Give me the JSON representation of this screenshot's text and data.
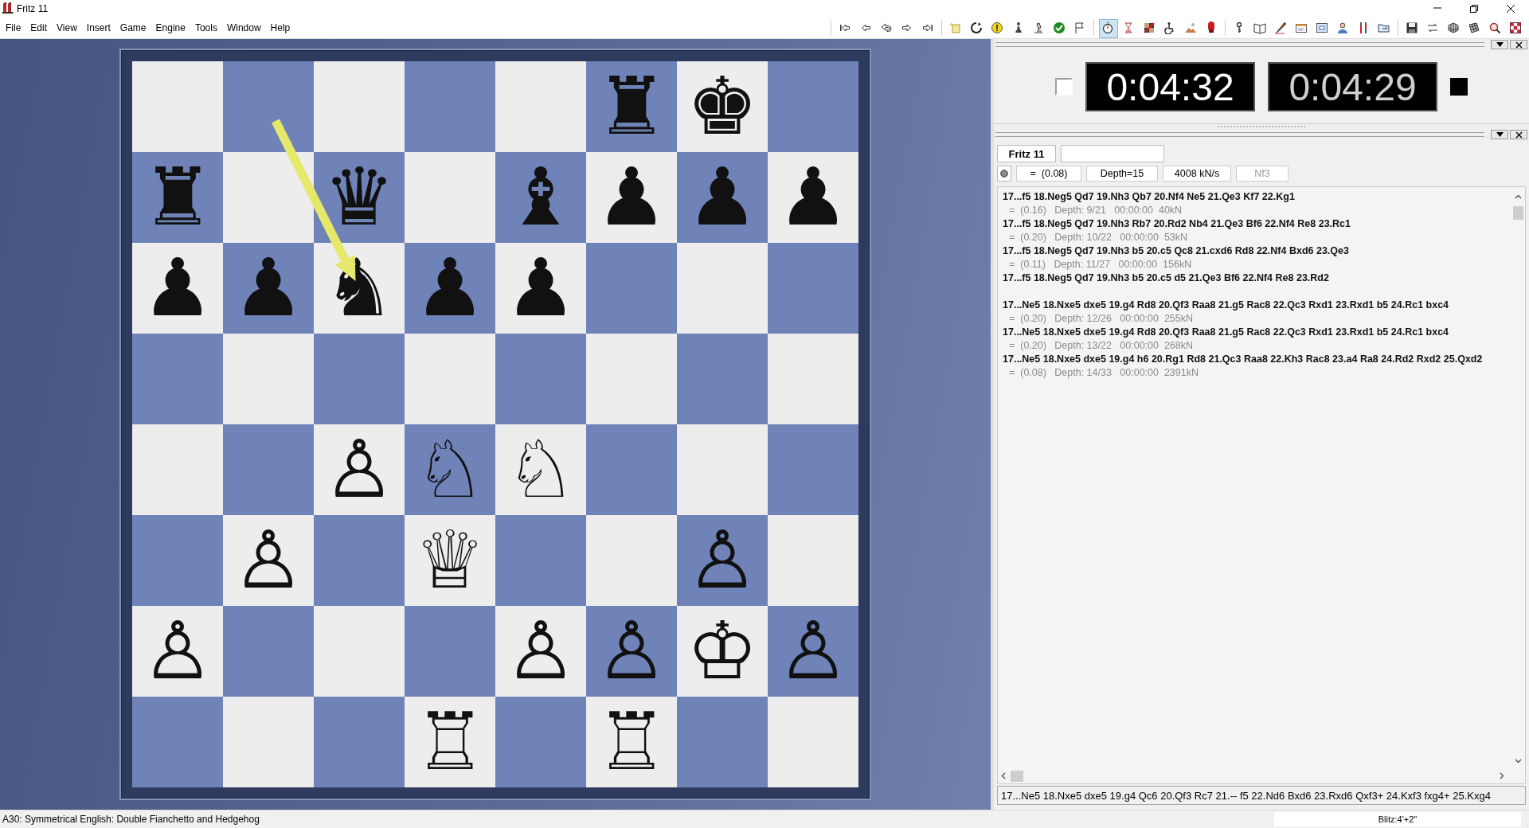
{
  "window": {
    "title": "Fritz 11"
  },
  "menu": [
    {
      "label": "File"
    },
    {
      "label": "Edit"
    },
    {
      "label": "View"
    },
    {
      "label": "Insert"
    },
    {
      "label": "Game"
    },
    {
      "label": "Engine"
    },
    {
      "label": "Tools"
    },
    {
      "label": "Window"
    },
    {
      "label": "Help"
    }
  ],
  "toolbar": [
    [
      {
        "pressed": false
      },
      {
        "pressed": false
      },
      {
        "pressed": false
      },
      {
        "pressed": false
      },
      {
        "pressed": false
      }
    ],
    [
      {
        "pressed": false
      },
      {
        "pressed": false
      },
      {
        "pressed": false
      },
      {
        "pressed": false
      },
      {
        "pressed": false
      },
      {
        "pressed": false
      },
      {
        "pressed": false
      }
    ],
    [
      {
        "pressed": true
      },
      {
        "pressed": false
      },
      {
        "pressed": false
      },
      {
        "pressed": false
      },
      {
        "pressed": false
      },
      {
        "pressed": false
      }
    ],
    [
      {
        "pressed": false
      },
      {
        "pressed": false
      },
      {
        "pressed": false
      },
      {
        "pressed": false
      },
      {
        "pressed": false
      },
      {
        "pressed": false
      },
      {
        "pressed": false
      },
      {
        "pressed": false
      }
    ],
    [
      {
        "pressed": false
      },
      {
        "pressed": false
      },
      {
        "pressed": false
      },
      {
        "pressed": false
      },
      {
        "pressed": false
      },
      {
        "pressed": false
      }
    ]
  ],
  "board": {
    "ranks": [
      [
        {
          "dark": false
        },
        {
          "dark": true
        },
        {
          "dark": false
        },
        {
          "dark": true
        },
        {
          "dark": false
        },
        {
          "dark": true,
          "glyph": "♜"
        },
        {
          "dark": false,
          "glyph": "♚"
        },
        {
          "dark": true
        }
      ],
      [
        {
          "dark": true,
          "glyph": "♜"
        },
        {
          "dark": false
        },
        {
          "dark": true,
          "glyph": "♛"
        },
        {
          "dark": false
        },
        {
          "dark": true,
          "glyph": "♝"
        },
        {
          "dark": false,
          "glyph": "♟"
        },
        {
          "dark": true,
          "glyph": "♟"
        },
        {
          "dark": false,
          "glyph": "♟"
        }
      ],
      [
        {
          "dark": false,
          "glyph": "♟"
        },
        {
          "dark": true,
          "glyph": "♟"
        },
        {
          "dark": false,
          "glyph": "♞"
        },
        {
          "dark": true,
          "glyph": "♟"
        },
        {
          "dark": false,
          "glyph": "♟"
        },
        {
          "dark": true
        },
        {
          "dark": false
        },
        {
          "dark": true
        }
      ],
      [
        {
          "dark": true
        },
        {
          "dark": false
        },
        {
          "dark": true
        },
        {
          "dark": false
        },
        {
          "dark": true
        },
        {
          "dark": false
        },
        {
          "dark": true
        },
        {
          "dark": false
        }
      ],
      [
        {
          "dark": false
        },
        {
          "dark": true
        },
        {
          "dark": false,
          "glyph": "♙"
        },
        {
          "dark": true,
          "glyph": "♘"
        },
        {
          "dark": false,
          "glyph": "♘"
        },
        {
          "dark": true
        },
        {
          "dark": false
        },
        {
          "dark": true
        }
      ],
      [
        {
          "dark": true
        },
        {
          "dark": false,
          "glyph": "♙"
        },
        {
          "dark": true
        },
        {
          "dark": false,
          "glyph": "♕"
        },
        {
          "dark": true
        },
        {
          "dark": false
        },
        {
          "dark": true,
          "glyph": "♙"
        },
        {
          "dark": false
        }
      ],
      [
        {
          "dark": false,
          "glyph": "♙"
        },
        {
          "dark": true
        },
        {
          "dark": false
        },
        {
          "dark": true
        },
        {
          "dark": false,
          "glyph": "♙"
        },
        {
          "dark": true,
          "glyph": "♙"
        },
        {
          "dark": false,
          "glyph": "♔"
        },
        {
          "dark": true,
          "glyph": "♙"
        }
      ],
      [
        {
          "dark": true
        },
        {
          "dark": false
        },
        {
          "dark": true
        },
        {
          "dark": false,
          "glyph": "♖"
        },
        {
          "dark": true
        },
        {
          "dark": false,
          "glyph": "♖"
        },
        {
          "dark": true
        },
        {
          "dark": false
        }
      ]
    ],
    "arrows": [
      {
        "color": "#e6e86a"
      }
    ]
  },
  "clocks": [
    {
      "time": "0:04:32",
      "indicator_filled": false,
      "running": true
    },
    {
      "time": "0:04:29",
      "indicator_filled": true,
      "running": false
    }
  ],
  "engine": {
    "name": "Fritz 11",
    "status": [
      {
        "kind": "eval",
        "text": "=  (0.08)",
        "disabled": false
      },
      {
        "kind": "depth",
        "text": "Depth=15",
        "disabled": false
      },
      {
        "kind": "speed",
        "text": "4008 kN/s",
        "disabled": false
      },
      {
        "kind": "move",
        "text": "Nf3",
        "disabled": true
      }
    ],
    "analysis": [
      {
        "lines": [
          {
            "moves": "17...f5 18.Neg5 Qd7 19.Nh3 Qb7 20.Nf4 Ne5 21.Qe3 Kf7 22.Kg1",
            "info": "=  (0.16)   Depth: 9/21   00:00:00  40kN"
          },
          {
            "moves": "17...f5 18.Neg5 Qd7 19.Nh3 Rb7 20.Rd2 Nb4 21.Qe3 Bf6 22.Nf4 Re8 23.Rc1",
            "info": "=  (0.20)   Depth: 10/22   00:00:00  53kN"
          },
          {
            "moves": "17...f5 18.Neg5 Qd7 19.Nh3 b5 20.c5 Qc8 21.cxd6 Rd8 22.Nf4 Bxd6 23.Qe3",
            "info": "=  (0.11)   Depth: 11/27   00:00:00  156kN"
          },
          {
            "moves": "17...f5 18.Neg5 Qd7 19.Nh3 b5 20.c5 d5 21.Qe3 Bf6 22.Nf4 Re8 23.Rd2"
          }
        ]
      },
      {
        "lines": [
          {
            "moves": "17...Ne5 18.Nxe5 dxe5 19.g4 Rd8 20.Qf3 Raa8 21.g5 Rac8 22.Qc3 Rxd1 23.Rxd1 b5 24.Rc1 bxc4",
            "info": "=  (0.20)   Depth: 12/26   00:00:00  255kN"
          },
          {
            "moves": "17...Ne5 18.Nxe5 dxe5 19.g4 Rd8 20.Qf3 Raa8 21.g5 Rac8 22.Qc3 Rxd1 23.Rxd1 b5 24.Rc1 bxc4",
            "info": "=  (0.20)   Depth: 13/22   00:00:00  268kN"
          },
          {
            "moves": "17...Ne5 18.Nxe5 dxe5 19.g4 h6 20.Rg1 Rd8 21.Qc3 Raa8 22.Kh3 Rac8 23.a4 Ra8 24.Rd2 Rxd2 25.Qxd2",
            "info": "=  (0.08)   Depth: 14/33   00:00:00  2391kN"
          }
        ]
      }
    ],
    "best_line": "17...Ne5 18.Nxe5 dxe5 19.g4 Qc6 20.Qf3 Rc7 21.-- f5 22.Nd6 Bxd6 23.Rxd6 Qxf3+ 24.Kxf3 fxg4+ 25.Kxg4"
  },
  "status_bar": {
    "opening": "A30: Symmetrical English: Double Fianchetto and Hedgehog",
    "time_control": "Blitz:4'+2\""
  }
}
